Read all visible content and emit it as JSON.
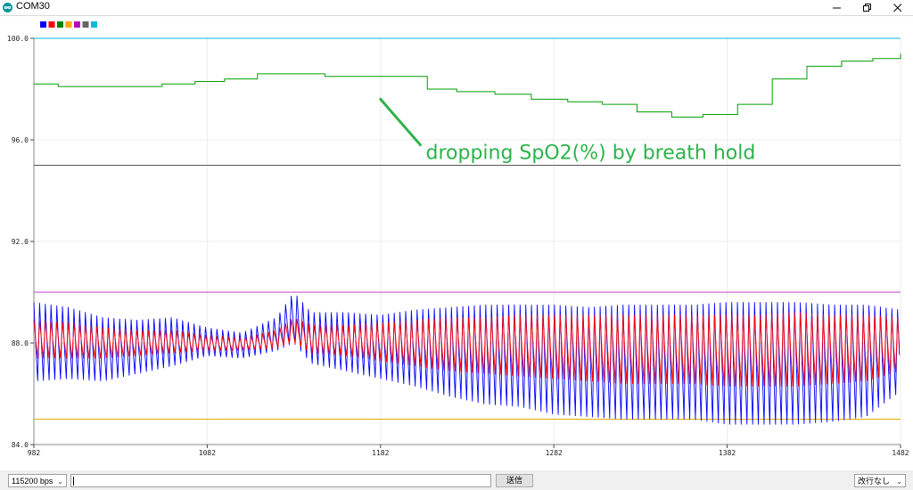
{
  "window": {
    "title": "COM30",
    "icon": "arduino-infinity-icon"
  },
  "chart_data": {
    "type": "line",
    "x_ticks": [
      "982",
      "1082",
      "1182",
      "1282",
      "1382",
      "1482"
    ],
    "y_ticks": [
      "100.0",
      "96.0",
      "92.0",
      "88.0",
      "84.0"
    ],
    "xlim": [
      982,
      1482
    ],
    "ylim": [
      84,
      100
    ],
    "grid": true,
    "legend_position": "top-left",
    "legend_colors": [
      "#0000ff",
      "#ff0000",
      "#008000",
      "#ffa500",
      "#c000c0",
      "#666666",
      "#00bbdd"
    ],
    "series": [
      {
        "color": "#0000ff",
        "kind": "pulse",
        "x": [
          982,
          1002,
          1022,
          1042,
          1062,
          1082,
          1102,
          1122,
          1132,
          1142,
          1162,
          1182,
          1202,
          1222,
          1242,
          1262,
          1282,
          1302,
          1322,
          1342,
          1362,
          1382,
          1402,
          1422,
          1442,
          1462,
          1482
        ],
        "peak": [
          89.6,
          89.4,
          89.0,
          88.9,
          89.0,
          88.6,
          88.4,
          89.0,
          90.0,
          89.2,
          89.2,
          89.1,
          89.3,
          89.4,
          89.5,
          89.5,
          89.5,
          89.4,
          89.5,
          89.5,
          89.5,
          89.6,
          89.6,
          89.6,
          89.5,
          89.5,
          89.3
        ],
        "trough": [
          86.5,
          86.6,
          86.5,
          86.8,
          87.1,
          87.5,
          87.4,
          87.7,
          88.0,
          87.2,
          86.9,
          86.6,
          86.3,
          85.9,
          85.6,
          85.5,
          85.2,
          85.1,
          85.0,
          85.0,
          85.0,
          84.8,
          84.8,
          84.8,
          84.9,
          85.1,
          86.1
        ]
      },
      {
        "color": "#ff0000",
        "kind": "pulse",
        "x": [
          982,
          1002,
          1022,
          1042,
          1062,
          1082,
          1102,
          1122,
          1132,
          1142,
          1162,
          1182,
          1202,
          1222,
          1242,
          1262,
          1282,
          1302,
          1322,
          1342,
          1362,
          1382,
          1402,
          1422,
          1442,
          1462,
          1482
        ],
        "peak": [
          88.9,
          88.8,
          88.6,
          88.5,
          88.5,
          88.3,
          88.2,
          88.5,
          89.0,
          88.7,
          88.7,
          88.8,
          88.9,
          89.0,
          89.0,
          89.1,
          89.1,
          89.1,
          89.1,
          89.1,
          89.1,
          89.1,
          89.1,
          89.2,
          89.1,
          89.1,
          89.0
        ],
        "trough": [
          87.4,
          87.4,
          87.4,
          87.5,
          87.6,
          87.7,
          87.7,
          87.8,
          88.0,
          87.6,
          87.5,
          87.3,
          87.1,
          86.9,
          86.8,
          86.7,
          86.6,
          86.5,
          86.4,
          86.4,
          86.4,
          86.3,
          86.3,
          86.3,
          86.4,
          86.5,
          86.9
        ]
      },
      {
        "color": "#00a000",
        "kind": "step",
        "x": [
          982,
          996,
          1014,
          1056,
          1075,
          1092,
          1111,
          1150,
          1188,
          1209,
          1226,
          1248,
          1269,
          1290,
          1310,
          1330,
          1350,
          1368,
          1388,
          1408,
          1428,
          1448,
          1466,
          1482
        ],
        "y": [
          98.2,
          98.1,
          98.1,
          98.2,
          98.3,
          98.4,
          98.6,
          98.5,
          98.5,
          98.0,
          97.9,
          97.8,
          97.6,
          97.5,
          97.4,
          97.1,
          96.9,
          97.0,
          97.4,
          98.4,
          98.9,
          99.1,
          99.2,
          99.4
        ]
      },
      {
        "color": "#00bbdd",
        "kind": "constant",
        "y": 100.0
      },
      {
        "color": "#555555",
        "kind": "constant",
        "y": 95.0
      },
      {
        "color": "#c040c0",
        "kind": "constant",
        "y": 90.0
      },
      {
        "color": "#e0b000",
        "kind": "constant",
        "y": 85.0
      }
    ],
    "annotation": {
      "text": "dropping SpO2(%) by breath hold",
      "color": "#2db34a",
      "points_to": {
        "x": 1182,
        "y": 97.6
      },
      "arrow_tail": {
        "x": 1205,
        "y": 95.8
      }
    }
  },
  "statusbar": {
    "baud_value": "115200 bps",
    "send_input_value": "",
    "send_label": "送信",
    "line_ending_value": "改行なし"
  }
}
